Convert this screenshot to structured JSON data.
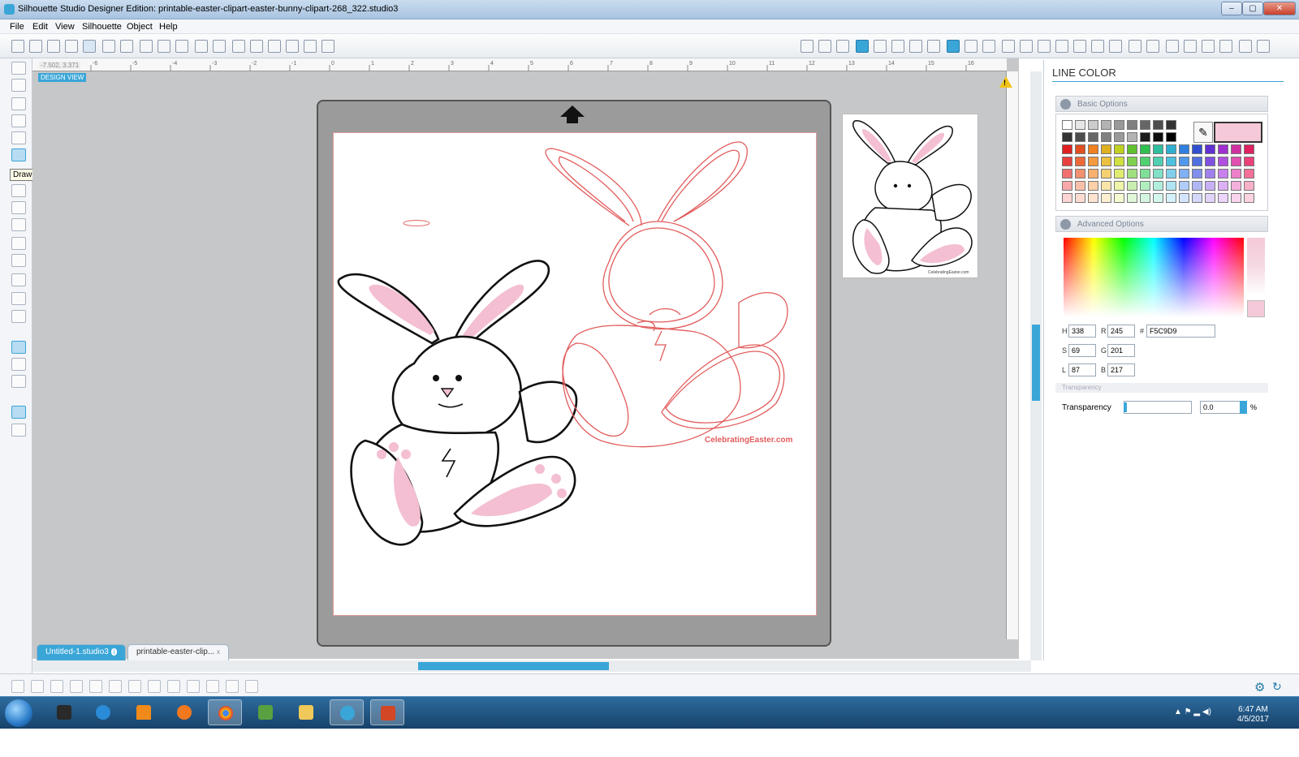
{
  "window": {
    "title": "Silhouette Studio Designer Edition: printable-easter-clipart-easter-bunny-clipart-268_322.studio3",
    "min": "–",
    "max": "▢",
    "close": "✕"
  },
  "menu": [
    "File",
    "Edit",
    "View",
    "Silhouette",
    "Object",
    "Help"
  ],
  "tooltip": "Draw an Ellipse",
  "canvas": {
    "coord_readout": "-7.502, 3.371",
    "design_view": "DESIGN VIEW",
    "ruler_ticks": [
      "-6",
      "-5",
      "-4",
      "-3",
      "-2",
      "-1",
      "0",
      "1",
      "2",
      "3",
      "4",
      "5",
      "6",
      "7",
      "8",
      "9",
      "10",
      "11",
      "12",
      "13",
      "14",
      "15",
      "16"
    ],
    "watermark": "CelebratingEaster.com",
    "thumb_watermark": "CelebratingEaster.com"
  },
  "tabs": [
    {
      "label": "Untitled-1.studio3",
      "badge": "i"
    },
    {
      "label": "printable-easter-clip...",
      "badge": "x"
    }
  ],
  "panel": {
    "title": "LINE COLOR",
    "basic_options": "Basic Options",
    "advanced_options": "Advanced Options",
    "transparency_section": "Transparency",
    "fields": {
      "h_label": "H",
      "h": "338",
      "s_label": "S",
      "s": "69",
      "l_label": "L",
      "l": "87",
      "r_label": "R",
      "r": "245",
      "g_label": "G",
      "g": "201",
      "b_label": "B",
      "b": "217",
      "hex_label": "#",
      "hex": "F5C9D9"
    },
    "transparency_label": "Transparency",
    "transparency_value": "0.0",
    "transparency_unit": "%",
    "selected_color": "#F5C9D9"
  },
  "swatch_rows": [
    [
      "#ffffff",
      "#e6e6e6",
      "#cccccc",
      "#b3b3b3",
      "#999999",
      "#808080",
      "#666666",
      "#4d4d4d",
      "#333333"
    ],
    [
      "#333333",
      "#4d4d4d",
      "#666666",
      "#808080",
      "#999999",
      "#b3b3b3",
      "#1a1a1a",
      "#0d0d0d",
      "#000000"
    ],
    [
      "#e02020",
      "#e05020",
      "#f08020",
      "#e0b020",
      "#c0d020",
      "#60c030",
      "#30c050",
      "#30c0a0",
      "#30b0d0",
      "#3080e0",
      "#3050d0",
      "#6030d0",
      "#a030d0",
      "#d030a0",
      "#e02060"
    ],
    [
      "#e84040",
      "#ec6a3a",
      "#f49a40",
      "#ecc040",
      "#d0e040",
      "#80d050",
      "#50d070",
      "#50d0b0",
      "#50c0e0",
      "#5098ec",
      "#5070e0",
      "#8050e0",
      "#b050e0",
      "#e050b0",
      "#ec4078"
    ],
    [
      "#f07070",
      "#f29070",
      "#f8b070",
      "#f4d070",
      "#e0ec70",
      "#a0e080",
      "#80e098",
      "#80e0c8",
      "#80d0ec",
      "#80b0f4",
      "#8090ec",
      "#a080ec",
      "#c880ec",
      "#ec80c8",
      "#f47098"
    ],
    [
      "#f8a8a8",
      "#f8c0a8",
      "#fcd0a8",
      "#f8e4a8",
      "#eef4a8",
      "#c8eeb0",
      "#b0eec0",
      "#b0eedc",
      "#b0e4f4",
      "#b0ccf8",
      "#b0b8f4",
      "#c8b0f4",
      "#dcb0f4",
      "#f4b0dc",
      "#f8b0c8"
    ],
    [
      "#fcd4d4",
      "#fcdcd0",
      "#fee4d0",
      "#fcf0d0",
      "#f6fad0",
      "#e0f6d8",
      "#d4f6e0",
      "#d4f6ec",
      "#d4f0fa",
      "#d4e4fc",
      "#d4d8fa",
      "#e0d4fa",
      "#ecd4fa",
      "#fad4ec",
      "#fcd4e0"
    ]
  ],
  "taskbar": {
    "time": "6:47 AM",
    "date": "4/5/2017",
    "apps": [
      "explorer",
      "ie",
      "vlc",
      "media-player",
      "chrome",
      "xming",
      "file-explorer",
      "silhouette",
      "powerpoint"
    ]
  }
}
